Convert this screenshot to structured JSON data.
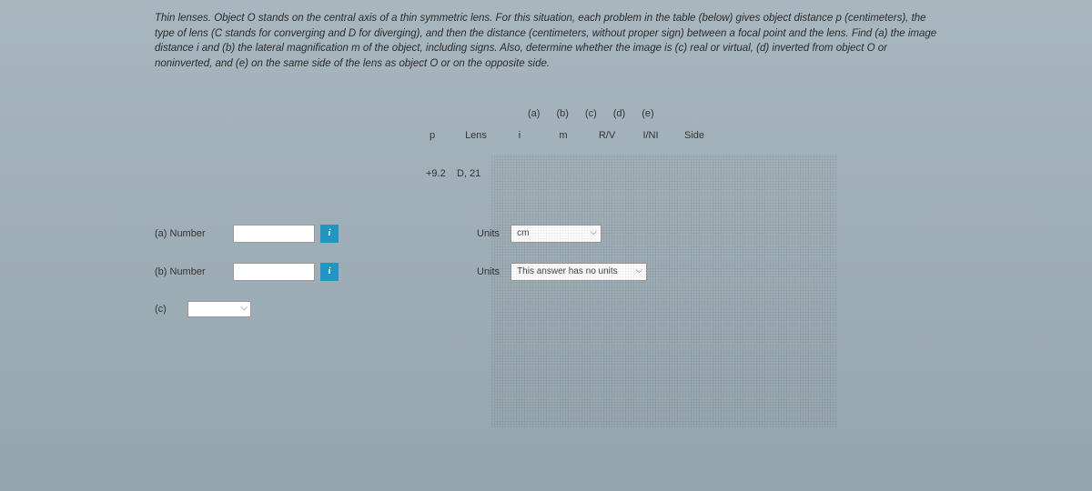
{
  "problem": {
    "text": "Thin lenses. Object O stands on the central axis of a thin symmetric lens. For this situation, each problem in the table (below) gives object distance p (centimeters), the type of lens (C stands for converging and D for diverging), and then the distance (centimeters, without proper sign) between a focal point and the lens. Find (a) the image distance i and (b) the lateral magnification m of the object, including signs. Also, determine whether the image is (c) real or virtual, (d) inverted from object O or noninverted, and (e) on the same side of the lens as object O or on the opposite side."
  },
  "table": {
    "group_headers": {
      "a": "(a)",
      "b": "(b)",
      "c": "(c)",
      "d": "(d)",
      "e": "(e)"
    },
    "col_headers": {
      "p": "p",
      "lens": "Lens",
      "i": "i",
      "m": "m",
      "rv": "R/V",
      "ini": "I/NI",
      "side": "Side"
    },
    "data": {
      "p_val": "+9.2",
      "lens_val": "D, 21"
    }
  },
  "answers": {
    "a": {
      "label": "(a)   Number",
      "units_label": "Units",
      "unit_value": "cm"
    },
    "b": {
      "label": "(b)   Number",
      "units_label": "Units",
      "unit_value": "This answer has no units"
    },
    "c": {
      "label": "(c)"
    }
  },
  "icons": {
    "info": "i"
  }
}
